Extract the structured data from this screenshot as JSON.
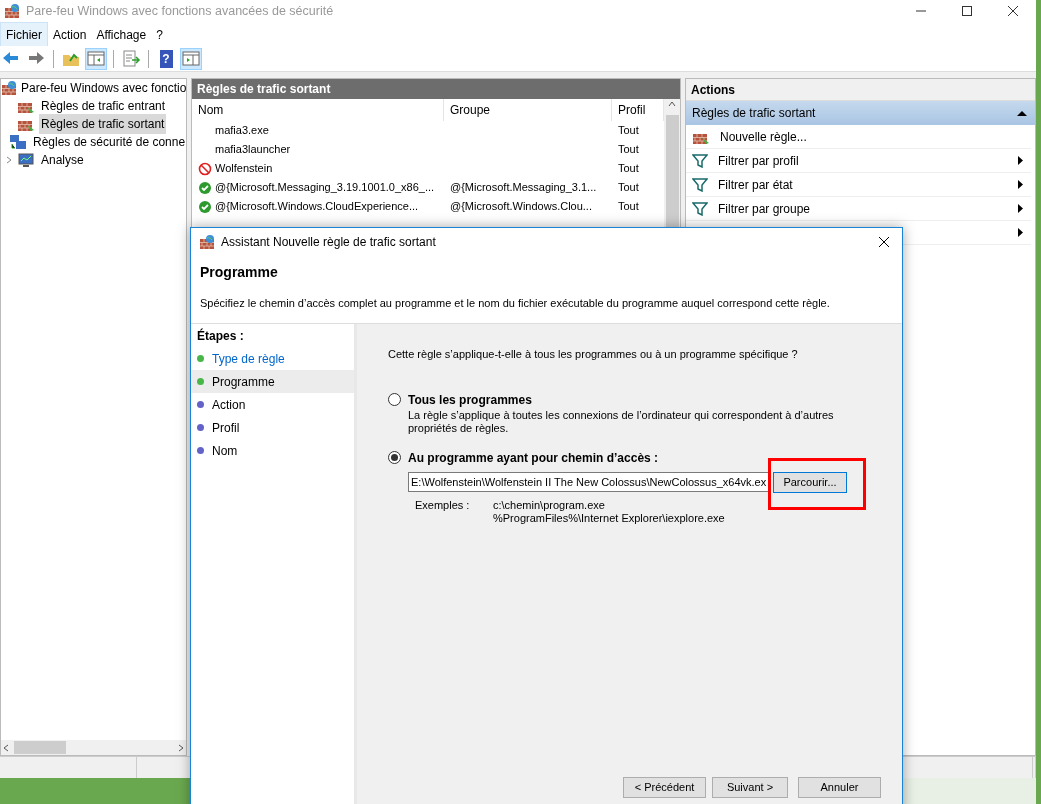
{
  "window": {
    "title": "Pare-feu Windows avec fonctions avancées de sécurité"
  },
  "menu": [
    {
      "label": "Fichier",
      "selected": true
    },
    {
      "label": "Action",
      "selected": false
    },
    {
      "label": "Affichage",
      "selected": false
    },
    {
      "label": "?",
      "selected": false
    }
  ],
  "toolbar": [
    {
      "kind": "back",
      "pressed": false
    },
    {
      "kind": "forward",
      "pressed": false
    },
    {
      "kind": "sep"
    },
    {
      "kind": "up",
      "pressed": false
    },
    {
      "kind": "tree",
      "pressed": true
    },
    {
      "kind": "sep"
    },
    {
      "kind": "export",
      "pressed": false
    },
    {
      "kind": "sep"
    },
    {
      "kind": "help",
      "label": "?",
      "pressed": false
    },
    {
      "kind": "pane",
      "pressed": true
    }
  ],
  "tree": {
    "label": "Pare-feu Windows avec fonctio",
    "children": [
      {
        "label": "Règles de trafic entrant",
        "kind": "in",
        "selected": false
      },
      {
        "label": "Règles de trafic sortant",
        "kind": "out",
        "selected": true
      },
      {
        "label": "Règles de sécurité de conne",
        "kind": "sec",
        "selected": false
      },
      {
        "label": "Analyse",
        "kind": "mon",
        "selected": false,
        "expandable": true
      }
    ]
  },
  "rules": {
    "title": "Règles de trafic sortant",
    "columns": [
      "Nom",
      "Groupe",
      "Profil"
    ],
    "rows": [
      {
        "kind": "plain",
        "name": "mafia3.exe",
        "profile": "Tout"
      },
      {
        "kind": "plain",
        "name": "mafia3launcher",
        "profile": "Tout"
      },
      {
        "kind": "blocked",
        "name": "Wolfenstein",
        "profile": "Tout"
      },
      {
        "kind": "allowed",
        "name": "@{Microsoft.Messaging_3.19.1001.0_x86_...",
        "group": "@{Microsoft.Messaging_3.1...",
        "profile": "Tout"
      },
      {
        "kind": "allowed",
        "name": "@{Microsoft.Windows.CloudExperience...",
        "group": "@{Microsoft.Windows.Clou...",
        "profile": "Tout"
      }
    ]
  },
  "actions": {
    "title": "Actions",
    "group": "Règles de trafic sortant",
    "items": [
      {
        "kind": "new",
        "label": "Nouvelle règle...",
        "submenu": false
      },
      {
        "kind": "filter",
        "label": "Filtrer par profil",
        "submenu": true
      },
      {
        "kind": "filter",
        "label": "Filtrer par état",
        "submenu": true
      },
      {
        "kind": "filter",
        "label": "Filtrer par groupe",
        "submenu": true
      },
      {
        "kind": "covered",
        "submenu": true
      }
    ]
  },
  "dialog": {
    "title": "Assistant Nouvelle règle de trafic sortant",
    "heading": "Programme",
    "description": "Spécifiez le chemin d’accès complet au programme et le nom du fichier exécutable du programme auquel correspond cette règle.",
    "steps_label": "Étapes :",
    "steps": [
      {
        "label": "Type de règle",
        "kind": "done",
        "selected": false
      },
      {
        "label": "Programme",
        "kind": "done",
        "selected": true
      },
      {
        "label": "Action",
        "kind": "pending",
        "selected": false
      },
      {
        "label": "Profil",
        "kind": "pending",
        "selected": false
      },
      {
        "label": "Nom",
        "kind": "pending",
        "selected": false
      }
    ],
    "question": "Cette règle s’applique-t-elle à tous les programmes ou à un programme spécifique ?",
    "options": [
      {
        "label": "Tous les programmes",
        "description": "La règle s’applique à toutes les connexions de l’ordinateur qui correspondent à d’autres propriétés de règles.",
        "selected": false
      },
      {
        "label": "Au programme ayant pour chemin d’accès :",
        "selected": true
      }
    ],
    "path": "E:\\Wolfenstein\\Wolfenstein II The New Colossus\\NewColossus_x64vk.ex",
    "browse": "Parcourir...",
    "examples_label": "Exemples :",
    "examples": [
      "c:\\chemin\\program.exe",
      "%ProgramFiles%\\Internet Explorer\\iexplore.exe"
    ],
    "buttons": [
      "< Précédent",
      "Suivant >",
      "Annuler"
    ]
  }
}
